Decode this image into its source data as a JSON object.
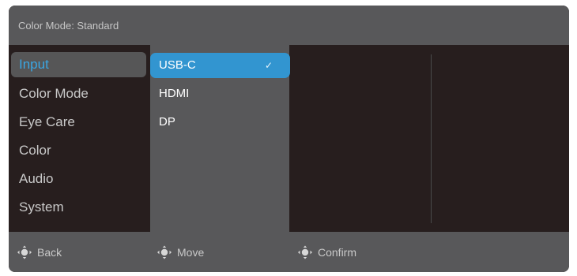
{
  "header": {
    "title": "Color Mode: Standard"
  },
  "menu": {
    "items": [
      {
        "label": "Input",
        "selected": true
      },
      {
        "label": "Color Mode"
      },
      {
        "label": "Eye Care"
      },
      {
        "label": "Color"
      },
      {
        "label": "Audio"
      },
      {
        "label": "System"
      }
    ]
  },
  "submenu": {
    "items": [
      {
        "label": "USB-C",
        "selected": true,
        "check": "✓"
      },
      {
        "label": "HDMI"
      },
      {
        "label": "DP"
      }
    ]
  },
  "footer": {
    "hints": [
      {
        "label": "Back",
        "icon": "dpad-left-icon"
      },
      {
        "label": "Move",
        "icon": "dpad-updown-icon"
      },
      {
        "label": "Confirm",
        "icon": "dpad-center-icon"
      }
    ]
  },
  "colors": {
    "accent": "#3295d0",
    "selected_text": "#3aa6e3",
    "panel": "#58585a",
    "background": "#271e1e"
  }
}
